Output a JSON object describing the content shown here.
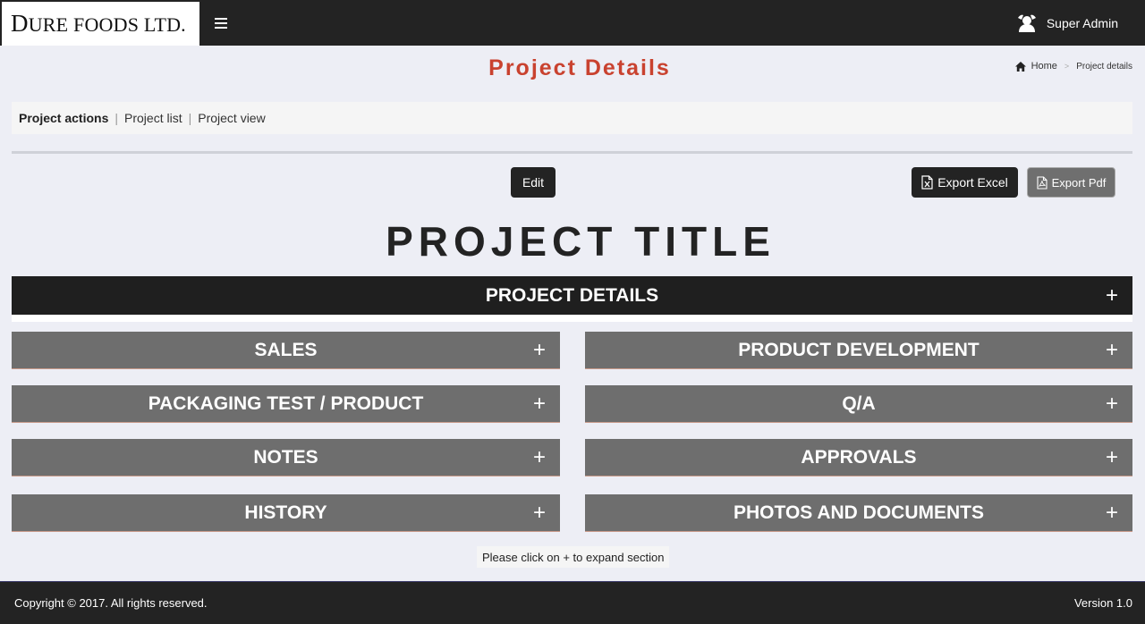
{
  "header": {
    "brand_initial": "D",
    "brand_rest": "URE FOODS LTD.",
    "menu_icon": "hamburger-icon",
    "user_icon": "user-avatar-icon",
    "user_name": "Super Admin"
  },
  "page": {
    "title": "Project Details",
    "breadcrumb": {
      "home_icon": "home-icon",
      "home": "Home",
      "separator": ">",
      "current": "Project details"
    }
  },
  "actions": {
    "label": "Project actions",
    "separator": "|",
    "links": [
      "Project list",
      "Project view"
    ]
  },
  "buttons": {
    "edit": "Edit",
    "export_excel": "Export Excel",
    "export_pdf": "Export Pdf",
    "excel_icon": "excel-file-icon",
    "pdf_icon": "pdf-file-icon"
  },
  "project_title": "PROJECT TITLE",
  "sections": {
    "main": "PROJECT DETAILS",
    "left": [
      "SALES",
      "PACKAGING TEST / PRODUCT",
      "NOTES",
      "HISTORY"
    ],
    "right": [
      "PRODUCT DEVELOPMENT",
      "Q/A",
      "APPROVALS",
      "PHOTOS AND DOCUMENTS"
    ],
    "expand_symbol": "+"
  },
  "hint": "Please click on + to expand section",
  "footer": {
    "copyright": "Copyright © 2017. All rights reserved.",
    "version": "Version 1.0"
  },
  "colors": {
    "accent_title": "#c9422f",
    "dark": "#232323",
    "section_gray": "#6e6e6e",
    "background": "#edeef5"
  }
}
